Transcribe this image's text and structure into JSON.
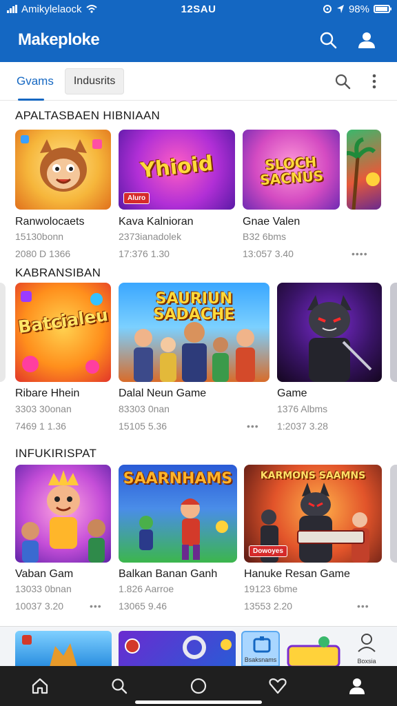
{
  "status_bar": {
    "carrier": "Amikylelaock",
    "time": "12SAU",
    "battery": "98%",
    "battery_level": 0.92
  },
  "app_bar": {
    "title": "Makeploke",
    "search_icon": "search-icon",
    "account_icon": "person-icon"
  },
  "tabs": {
    "active_label": "Gvams",
    "chip_label": "Indusrits",
    "search_icon": "search-icon",
    "more_icon": "more-vert-icon"
  },
  "sections": [
    {
      "title": "APALTASBAEN HIBNIAAN",
      "cards": [
        {
          "name": "Ranwolocaets",
          "sub": "15130bonn",
          "meta": "2080 D 1366",
          "thumb_text": "",
          "chip": ""
        },
        {
          "name": "Kava Kalnioran",
          "sub": "2373ianadolek",
          "meta": "17:376 1.30",
          "thumb_text": "Yhioid",
          "chip": "Aluro"
        },
        {
          "name": "Gnae Valen",
          "sub": "B32 6bms",
          "meta": "13:057 3.40",
          "thumb_text": "SLOCH SACNUS",
          "chip": ""
        },
        {
          "name": "",
          "sub": "",
          "meta": "",
          "thumb_text": "",
          "chip": ""
        }
      ]
    },
    {
      "title": "KABRANSIBAN",
      "cards": [
        {
          "name": "Ribare Hhein",
          "sub": "3303 30onan",
          "meta": "7469 1 1.36",
          "thumb_text": "Batcialeu",
          "chip": ""
        },
        {
          "name": "Dalal Neun Game",
          "sub": "83303 0nan",
          "meta": "15105 5.36",
          "thumb_text": "SAURIUN SADACHE",
          "chip": ""
        },
        {
          "name": "Game",
          "sub": "1376 Albms",
          "meta": "1:2037 3.28",
          "thumb_text": "",
          "chip": ""
        }
      ]
    },
    {
      "title": "INFUKIRISPAT",
      "cards": [
        {
          "name": "Vaban Gam",
          "sub": "13033 0bnan",
          "meta": "10037 3.20",
          "thumb_text": "",
          "chip": ""
        },
        {
          "name": "Balkan Banan Ganh",
          "sub": "1.826 Aarroe",
          "meta": "13065 9.46",
          "thumb_text": "SAARNHAMS",
          "chip": ""
        },
        {
          "name": "Hanuke Resan Game",
          "sub": "19123 6bme",
          "meta": "13553 2.20",
          "thumb_text": "KARMONS SAAMNS",
          "chip": "Dowoyes"
        }
      ]
    }
  ],
  "bottom_strip": {
    "labels": [
      "",
      "",
      "Bsaksnams",
      "",
      "Boxsia"
    ]
  },
  "nav": {
    "items": [
      "home-icon",
      "search-icon",
      "circle-icon",
      "heart-icon",
      "person-icon"
    ]
  },
  "colors": {
    "brand": "#1467c2",
    "nav_bg": "#1f1f1f"
  }
}
